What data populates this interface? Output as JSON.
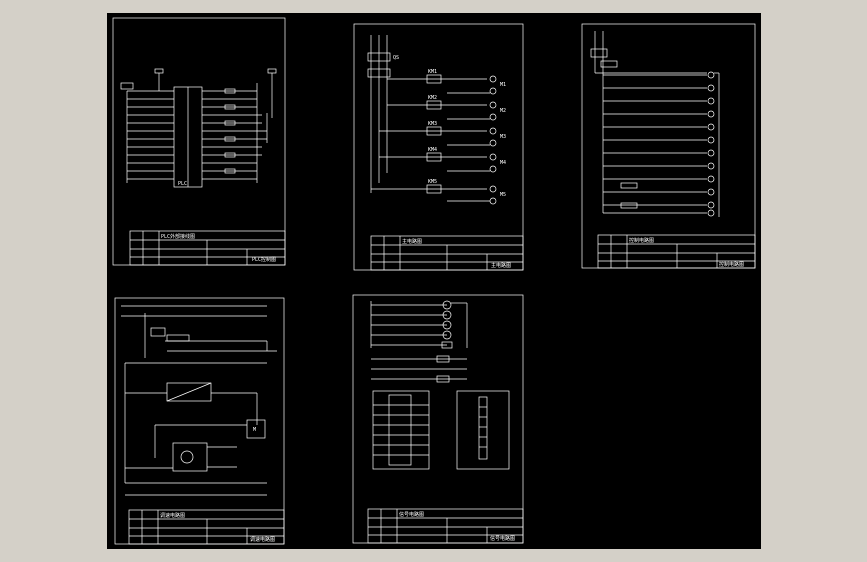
{
  "colors": {
    "background": "#000000",
    "lines": "#ffffff",
    "frame": "#d4d0c8"
  },
  "sheets": [
    {
      "id": "plc-io",
      "title_block": {
        "title": "PLC外部接线图",
        "label": "PLC控制图"
      },
      "plc_label": "PLC"
    },
    {
      "id": "main-circuit",
      "title_block": {
        "title": "主电路图",
        "label": "主电路图"
      },
      "breaker_label": "QS",
      "contactor_labels": [
        "KM1",
        "KM2",
        "KM3",
        "KM4",
        "KM5"
      ],
      "motor_labels": [
        "M1",
        "M2",
        "M3",
        "M4",
        "M5"
      ]
    },
    {
      "id": "control-circuit",
      "title_block": {
        "title": "控制电路图",
        "label": "控制电路图"
      },
      "branch_count": 14
    },
    {
      "id": "speed-circuit",
      "title_block": {
        "title": "调速电路图",
        "label": "调速电路图"
      },
      "motor_label": "M"
    },
    {
      "id": "signal-circuit",
      "title_block": {
        "title": "信号电路图",
        "label": "信号电路图"
      },
      "lamp_count": 4
    }
  ]
}
